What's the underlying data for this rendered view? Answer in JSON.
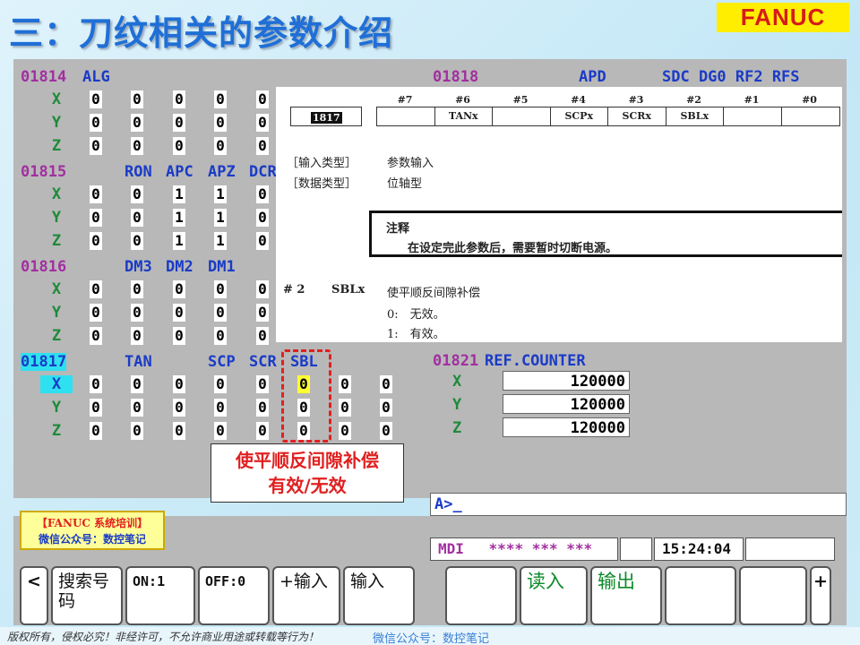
{
  "slide": {
    "title": "三：刀纹相关的参数介绍",
    "brand": "FANUC",
    "copyright": "版权所有，侵权必究！非经许可，不允许商业用途或转载等行为！",
    "wechat": "微信公众号：数控笔记",
    "training_line1": "【FANUC 系统培训】",
    "training_line2": "微信公众号：数控笔记"
  },
  "cnc": {
    "params": [
      {
        "num": "01814",
        "label": "ALG",
        "bits": [],
        "rows": [
          [
            "0",
            "0",
            "0",
            "0",
            "0"
          ],
          [
            "0",
            "0",
            "0",
            "0",
            "0"
          ],
          [
            "0",
            "0",
            "0",
            "0",
            "0"
          ]
        ]
      },
      {
        "num": "01815",
        "label": "",
        "bits": [
          "RON",
          "APC",
          "APZ",
          "DCR"
        ],
        "rows": [
          [
            "0",
            "0",
            "1",
            "1",
            "0"
          ],
          [
            "0",
            "0",
            "1",
            "1",
            "0"
          ],
          [
            "0",
            "0",
            "1",
            "1",
            "0"
          ]
        ]
      },
      {
        "num": "01816",
        "label": "",
        "bits": [
          "DM3",
          "DM2",
          "DM1"
        ],
        "rows": [
          [
            "0",
            "0",
            "0",
            "0",
            "0"
          ],
          [
            "0",
            "0",
            "0",
            "0",
            "0"
          ],
          [
            "0",
            "0",
            "0",
            "0",
            "0"
          ]
        ]
      },
      {
        "num": "01817",
        "label": "",
        "bits": [
          "TAN",
          "SCP",
          "SCR",
          "SBL"
        ],
        "rows": [
          [
            "0",
            "0",
            "0",
            "0",
            "0",
            "0",
            "0",
            "0"
          ],
          [
            "0",
            "0",
            "0",
            "0",
            "0",
            "0",
            "0",
            "0"
          ],
          [
            "0",
            "0",
            "0",
            "0",
            "0",
            "0",
            "0",
            "0"
          ]
        ]
      }
    ],
    "axes": [
      "X",
      "Y",
      "Z"
    ],
    "p1818": {
      "num": "01818",
      "label": "APD",
      "bits": "SDC DG0 RF2 RFS"
    },
    "p1821": {
      "num": "01821",
      "label": "REF.COUNTER",
      "values": [
        "120000",
        "120000",
        "120000"
      ]
    },
    "prompt": "A>_"
  },
  "manual": {
    "bit_headers": [
      "#7",
      "#6",
      "#5",
      "#4",
      "#3",
      "#2",
      "#1",
      "#0"
    ],
    "param_no": "1817",
    "bit_names": [
      "",
      "TANx",
      "",
      "SCPx",
      "SCRx",
      "SBLx",
      "",
      ""
    ],
    "input_type_label": "［输入类型］",
    "input_type_value": "参数输入",
    "data_type_label": "［数据类型］",
    "data_type_value": "位轴型",
    "note_title": "注释",
    "note_text": "在设定完此参数后，需要暂时切断电源。",
    "bit_id": "# 2",
    "bit_symbol": "SBLx",
    "bit_desc": "使平顺反间隙补偿",
    "opt0": "0:　无效。",
    "opt1": "1:　有效。"
  },
  "callout": {
    "line1": "使平顺反间隙补偿",
    "line2": "有效/无效"
  },
  "status": {
    "mode": "MDI",
    "stars": "**** *** ***",
    "time": "15:24:04"
  },
  "softkeys": {
    "left": "<",
    "search": "搜索号码",
    "on1": "ON:1",
    "off0": "OFF:0",
    "plus_input": "+输入",
    "input": "输入",
    "read": "读入",
    "output": "输出",
    "right": "+"
  }
}
